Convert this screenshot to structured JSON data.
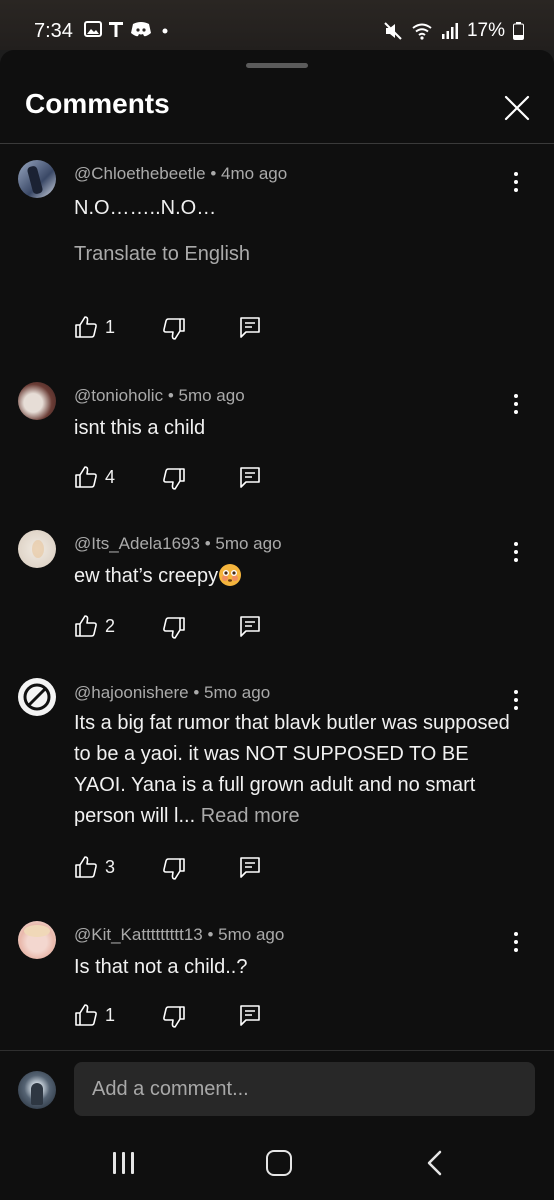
{
  "status_bar": {
    "time": "7:34",
    "battery": "17%",
    "icons": [
      "gallery-icon",
      "t-icon",
      "discord-icon",
      "dot-icon",
      "mute-icon",
      "wifi-icon",
      "signal-icon",
      "battery-icon"
    ]
  },
  "header": {
    "title": "Comments",
    "close_icon": "close-icon"
  },
  "comments": [
    {
      "user": "@Chloethebeetle",
      "time": "4mo ago",
      "text": "N.O……..N.O…",
      "translate": "Translate to English",
      "likes": "1"
    },
    {
      "user": "@tonioholic",
      "time": "5mo ago",
      "text": "isnt this a child",
      "likes": "4"
    },
    {
      "user": "@Its_Adela1693",
      "time": "5mo ago",
      "text": "ew that’s creepy",
      "emoji": "flushed-emoji",
      "likes": "2"
    },
    {
      "user": "@hajoonishere",
      "time": "5mo ago",
      "text": "Its a big fat rumor that blavk butler was supposed to be a yaoi. it was NOT SUPPOSED TO BE YAOI. Yana is a full grown adult and  no smart person will l...",
      "read_more": "Read more",
      "likes": "3"
    },
    {
      "user": "@Kit_Kattttttttt13",
      "time": "5mo ago",
      "text": "Is that not a child..?",
      "likes": "1"
    }
  ],
  "composer": {
    "placeholder": "Add a comment..."
  },
  "colors": {
    "background": "#0f0f0f",
    "text": "#f1f1f1",
    "secondary": "#aaaaaa",
    "input_bg": "#282828"
  }
}
